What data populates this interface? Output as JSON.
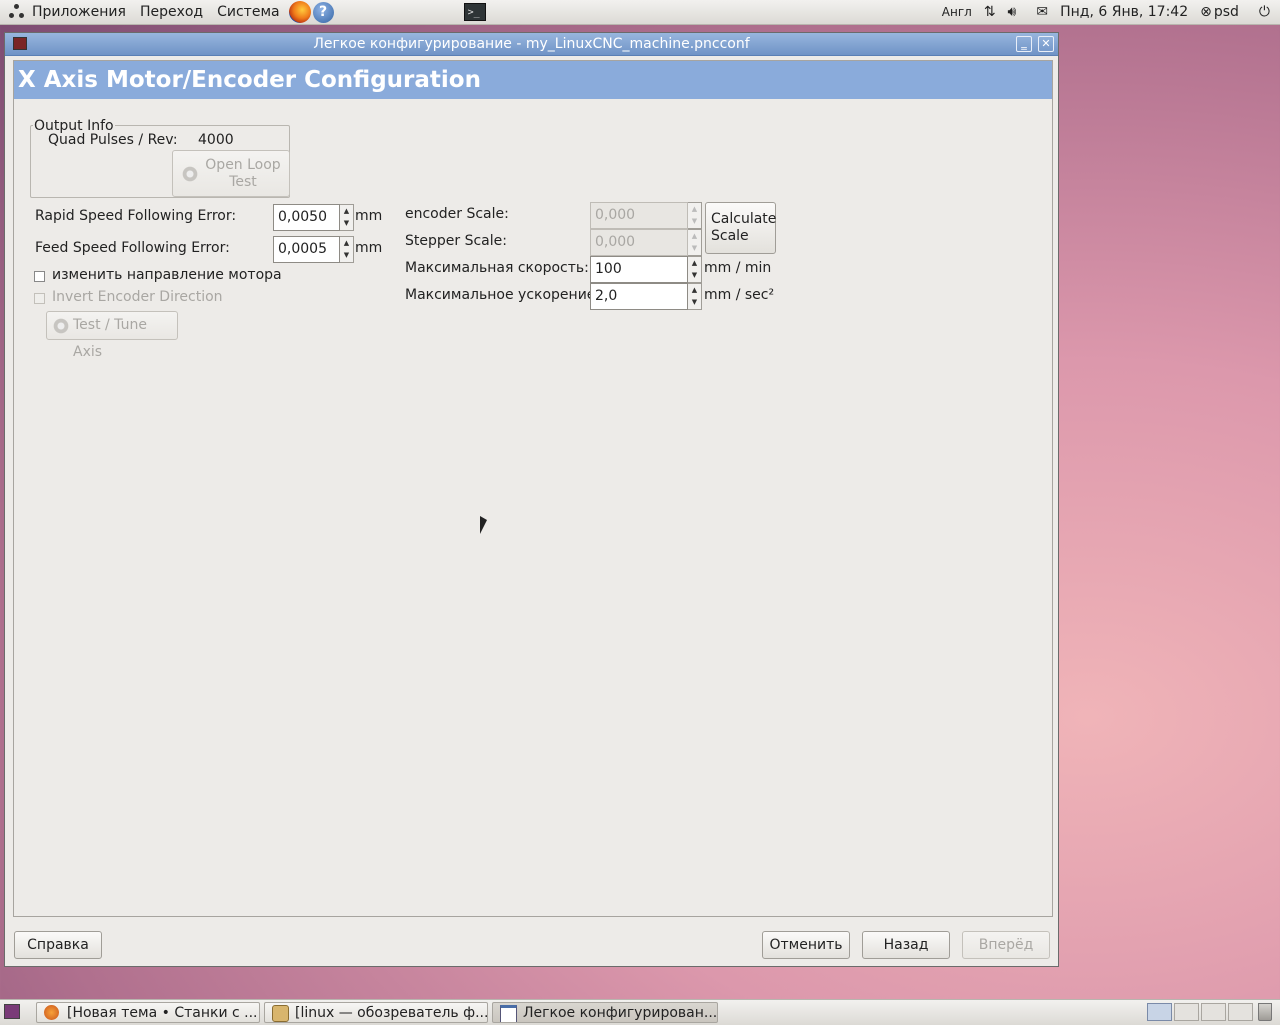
{
  "top_panel": {
    "menus": [
      "Приложения",
      "Переход",
      "Система"
    ],
    "keyboard_layout": "Англ",
    "datetime": "Пнд, 6 Янв, 17:42",
    "user": "psd"
  },
  "window": {
    "title": "Легкое конфигурирование - my_LinuxCNC_machine.pncconf",
    "minimize_glyph": "‗",
    "close_glyph": "✕"
  },
  "page": {
    "title": "X Axis Motor/Encoder Configuration"
  },
  "output_info": {
    "title": "Output Info",
    "quad_pulses_label": "Quad Pulses / Rev:",
    "quad_pulses_value": "4000",
    "open_loop_line1": "Open Loop",
    "open_loop_line2": "Test"
  },
  "left_form": {
    "rapid_label": "Rapid Speed Following Error:",
    "rapid_value": "0,0050",
    "rapid_unit": "mm",
    "feed_label": "Feed Speed Following Error:",
    "feed_value": "0,0005",
    "feed_unit": "mm",
    "reverse_motor_label": "изменить направление мотора",
    "reverse_motor_checked": false,
    "invert_encoder_label": "Invert Encoder Direction",
    "invert_encoder_checked": false,
    "test_tune_label": "Test / Tune Axis"
  },
  "right_form": {
    "encoder_scale_label": "encoder Scale:",
    "encoder_scale_value": "0,000",
    "stepper_scale_label": "Stepper Scale:",
    "stepper_scale_value": "0,000",
    "calc_line1": "Calculate",
    "calc_line2": "Scale",
    "max_speed_label": "Максимальная скорость:",
    "max_speed_value": "100",
    "max_speed_unit": "mm / min",
    "max_accel_label": "Максимальное ускорение:",
    "max_accel_value": "2,0",
    "max_accel_unit": "mm / sec²"
  },
  "footer": {
    "help": "Справка",
    "cancel": "Отменить",
    "back": "Назад",
    "forward": "Вперёд"
  },
  "taskbar": {
    "tasks": [
      "[Новая тема • Станки с ...",
      "[linux — обозреватель ф...",
      "Легкое конфигурирован..."
    ]
  },
  "colors": {
    "header_bg": "#8aabdb",
    "titlebar": "#7a9cd0"
  }
}
